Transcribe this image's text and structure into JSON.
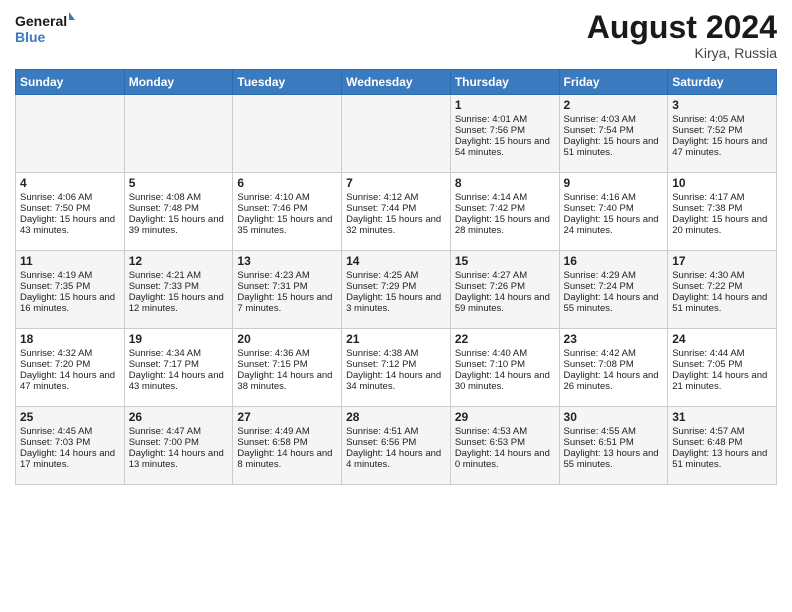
{
  "header": {
    "logo_line1": "General",
    "logo_line2": "Blue",
    "month": "August 2024",
    "location": "Kirya, Russia"
  },
  "days_of_week": [
    "Sunday",
    "Monday",
    "Tuesday",
    "Wednesday",
    "Thursday",
    "Friday",
    "Saturday"
  ],
  "weeks": [
    [
      {
        "day": "",
        "sunrise": "",
        "sunset": "",
        "daylight": ""
      },
      {
        "day": "",
        "sunrise": "",
        "sunset": "",
        "daylight": ""
      },
      {
        "day": "",
        "sunrise": "",
        "sunset": "",
        "daylight": ""
      },
      {
        "day": "",
        "sunrise": "",
        "sunset": "",
        "daylight": ""
      },
      {
        "day": "1",
        "sunrise": "Sunrise: 4:01 AM",
        "sunset": "Sunset: 7:56 PM",
        "daylight": "Daylight: 15 hours and 54 minutes."
      },
      {
        "day": "2",
        "sunrise": "Sunrise: 4:03 AM",
        "sunset": "Sunset: 7:54 PM",
        "daylight": "Daylight: 15 hours and 51 minutes."
      },
      {
        "day": "3",
        "sunrise": "Sunrise: 4:05 AM",
        "sunset": "Sunset: 7:52 PM",
        "daylight": "Daylight: 15 hours and 47 minutes."
      }
    ],
    [
      {
        "day": "4",
        "sunrise": "Sunrise: 4:06 AM",
        "sunset": "Sunset: 7:50 PM",
        "daylight": "Daylight: 15 hours and 43 minutes."
      },
      {
        "day": "5",
        "sunrise": "Sunrise: 4:08 AM",
        "sunset": "Sunset: 7:48 PM",
        "daylight": "Daylight: 15 hours and 39 minutes."
      },
      {
        "day": "6",
        "sunrise": "Sunrise: 4:10 AM",
        "sunset": "Sunset: 7:46 PM",
        "daylight": "Daylight: 15 hours and 35 minutes."
      },
      {
        "day": "7",
        "sunrise": "Sunrise: 4:12 AM",
        "sunset": "Sunset: 7:44 PM",
        "daylight": "Daylight: 15 hours and 32 minutes."
      },
      {
        "day": "8",
        "sunrise": "Sunrise: 4:14 AM",
        "sunset": "Sunset: 7:42 PM",
        "daylight": "Daylight: 15 hours and 28 minutes."
      },
      {
        "day": "9",
        "sunrise": "Sunrise: 4:16 AM",
        "sunset": "Sunset: 7:40 PM",
        "daylight": "Daylight: 15 hours and 24 minutes."
      },
      {
        "day": "10",
        "sunrise": "Sunrise: 4:17 AM",
        "sunset": "Sunset: 7:38 PM",
        "daylight": "Daylight: 15 hours and 20 minutes."
      }
    ],
    [
      {
        "day": "11",
        "sunrise": "Sunrise: 4:19 AM",
        "sunset": "Sunset: 7:35 PM",
        "daylight": "Daylight: 15 hours and 16 minutes."
      },
      {
        "day": "12",
        "sunrise": "Sunrise: 4:21 AM",
        "sunset": "Sunset: 7:33 PM",
        "daylight": "Daylight: 15 hours and 12 minutes."
      },
      {
        "day": "13",
        "sunrise": "Sunrise: 4:23 AM",
        "sunset": "Sunset: 7:31 PM",
        "daylight": "Daylight: 15 hours and 7 minutes."
      },
      {
        "day": "14",
        "sunrise": "Sunrise: 4:25 AM",
        "sunset": "Sunset: 7:29 PM",
        "daylight": "Daylight: 15 hours and 3 minutes."
      },
      {
        "day": "15",
        "sunrise": "Sunrise: 4:27 AM",
        "sunset": "Sunset: 7:26 PM",
        "daylight": "Daylight: 14 hours and 59 minutes."
      },
      {
        "day": "16",
        "sunrise": "Sunrise: 4:29 AM",
        "sunset": "Sunset: 7:24 PM",
        "daylight": "Daylight: 14 hours and 55 minutes."
      },
      {
        "day": "17",
        "sunrise": "Sunrise: 4:30 AM",
        "sunset": "Sunset: 7:22 PM",
        "daylight": "Daylight: 14 hours and 51 minutes."
      }
    ],
    [
      {
        "day": "18",
        "sunrise": "Sunrise: 4:32 AM",
        "sunset": "Sunset: 7:20 PM",
        "daylight": "Daylight: 14 hours and 47 minutes."
      },
      {
        "day": "19",
        "sunrise": "Sunrise: 4:34 AM",
        "sunset": "Sunset: 7:17 PM",
        "daylight": "Daylight: 14 hours and 43 minutes."
      },
      {
        "day": "20",
        "sunrise": "Sunrise: 4:36 AM",
        "sunset": "Sunset: 7:15 PM",
        "daylight": "Daylight: 14 hours and 38 minutes."
      },
      {
        "day": "21",
        "sunrise": "Sunrise: 4:38 AM",
        "sunset": "Sunset: 7:12 PM",
        "daylight": "Daylight: 14 hours and 34 minutes."
      },
      {
        "day": "22",
        "sunrise": "Sunrise: 4:40 AM",
        "sunset": "Sunset: 7:10 PM",
        "daylight": "Daylight: 14 hours and 30 minutes."
      },
      {
        "day": "23",
        "sunrise": "Sunrise: 4:42 AM",
        "sunset": "Sunset: 7:08 PM",
        "daylight": "Daylight: 14 hours and 26 minutes."
      },
      {
        "day": "24",
        "sunrise": "Sunrise: 4:44 AM",
        "sunset": "Sunset: 7:05 PM",
        "daylight": "Daylight: 14 hours and 21 minutes."
      }
    ],
    [
      {
        "day": "25",
        "sunrise": "Sunrise: 4:45 AM",
        "sunset": "Sunset: 7:03 PM",
        "daylight": "Daylight: 14 hours and 17 minutes."
      },
      {
        "day": "26",
        "sunrise": "Sunrise: 4:47 AM",
        "sunset": "Sunset: 7:00 PM",
        "daylight": "Daylight: 14 hours and 13 minutes."
      },
      {
        "day": "27",
        "sunrise": "Sunrise: 4:49 AM",
        "sunset": "Sunset: 6:58 PM",
        "daylight": "Daylight: 14 hours and 8 minutes."
      },
      {
        "day": "28",
        "sunrise": "Sunrise: 4:51 AM",
        "sunset": "Sunset: 6:56 PM",
        "daylight": "Daylight: 14 hours and 4 minutes."
      },
      {
        "day": "29",
        "sunrise": "Sunrise: 4:53 AM",
        "sunset": "Sunset: 6:53 PM",
        "daylight": "Daylight: 14 hours and 0 minutes."
      },
      {
        "day": "30",
        "sunrise": "Sunrise: 4:55 AM",
        "sunset": "Sunset: 6:51 PM",
        "daylight": "Daylight: 13 hours and 55 minutes."
      },
      {
        "day": "31",
        "sunrise": "Sunrise: 4:57 AM",
        "sunset": "Sunset: 6:48 PM",
        "daylight": "Daylight: 13 hours and 51 minutes."
      }
    ]
  ]
}
